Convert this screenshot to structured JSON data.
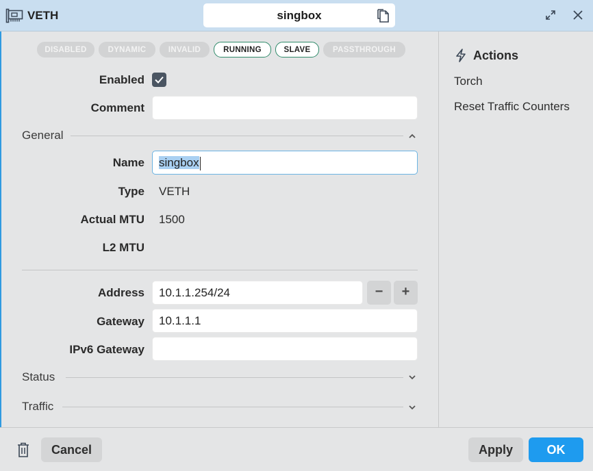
{
  "window": {
    "type_label": "VETH",
    "name": "singbox",
    "icons": {
      "interface": "network-card-icon",
      "copy": "copy-icon",
      "expand": "expand-icon",
      "close": "close-icon"
    }
  },
  "flags": [
    {
      "label": "DISABLED",
      "active": false
    },
    {
      "label": "DYNAMIC",
      "active": false
    },
    {
      "label": "INVALID",
      "active": false
    },
    {
      "label": "RUNNING",
      "active": true
    },
    {
      "label": "SLAVE",
      "active": true
    },
    {
      "label": "PASSTHROUGH",
      "active": false
    }
  ],
  "form": {
    "enabled_label": "Enabled",
    "enabled_checked": true,
    "comment_label": "Comment",
    "comment_value": ""
  },
  "general": {
    "title": "General",
    "name_label": "Name",
    "name_value": "singbox",
    "type_label": "Type",
    "type_value": "VETH",
    "actual_mtu_label": "Actual MTU",
    "actual_mtu_value": "1500",
    "l2_mtu_label": "L2 MTU",
    "l2_mtu_value": "",
    "address_label": "Address",
    "address_value": "10.1.1.254/24",
    "remove_label": "−",
    "add_label": "+",
    "gateway_label": "Gateway",
    "gateway_value": "10.1.1.1",
    "ipv6_gateway_label": "IPv6 Gateway",
    "ipv6_gateway_value": ""
  },
  "sections": {
    "status": "Status",
    "traffic": "Traffic"
  },
  "actions": {
    "title": "Actions",
    "items": [
      "Torch",
      "Reset Traffic Counters"
    ]
  },
  "footer": {
    "cancel": "Cancel",
    "apply": "Apply",
    "ok": "OK"
  },
  "colors": {
    "accent": "#1e9bef",
    "flag_active_border": "#2f8a6a",
    "titlebar": "#c9def0"
  }
}
